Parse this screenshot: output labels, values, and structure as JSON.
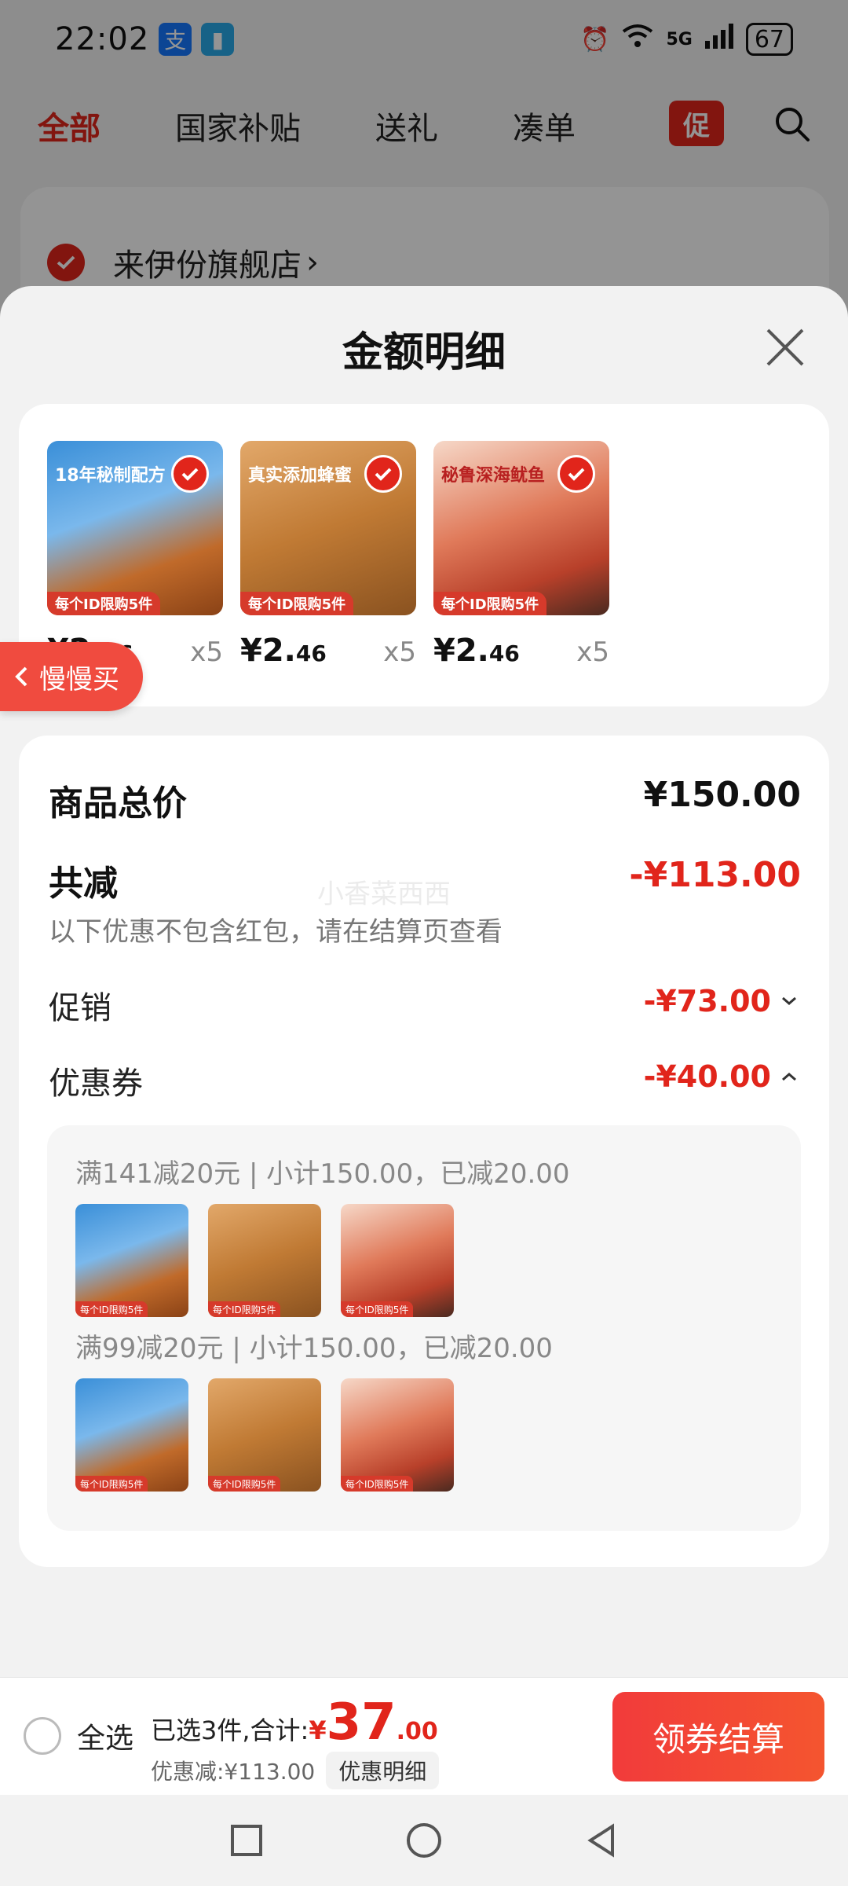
{
  "status_bar": {
    "time": "22:02",
    "battery": "67",
    "network": "5G"
  },
  "top_nav": {
    "items": [
      "全部",
      "国家补贴",
      "送礼",
      "凑单"
    ],
    "promo_label": "促"
  },
  "shop": {
    "name": "来伊份旗舰店",
    "chevron": "›"
  },
  "sheet": {
    "title": "金额明细",
    "products": [
      {
        "img_title": "18年秘制配方",
        "limit": "每个ID限购5件",
        "price_int": "¥2.",
        "price_dec": "46",
        "qty": "x5"
      },
      {
        "img_title": "真实添加蜂蜜",
        "limit": "每个ID限购5件",
        "price_int": "¥2.",
        "price_dec": "46",
        "qty": "x5"
      },
      {
        "img_title": "秘鲁深海鱿鱼",
        "limit": "每个ID限购5件",
        "price_int": "¥2.",
        "price_dec": "46",
        "qty": "x5"
      }
    ],
    "float_button": "慢慢买",
    "total_label": "商品总价",
    "total_value": "¥150.00",
    "reduce_label": "共减",
    "reduce_value": "-¥113.00",
    "reduce_note": "以下优惠不包含红包，请在结算页查看",
    "watermark": "小香菜西西",
    "promo_label": "促销",
    "promo_value": "-¥73.00",
    "coupon_label": "优惠券",
    "coupon_value": "-¥40.00",
    "coupon_rules": [
      "满141减20元 | 小计150.00，已减20.00",
      "满99减20元 | 小计150.00，已减20.00"
    ]
  },
  "bottom_bar": {
    "select_all": "全选",
    "selected_text": "已选3件,合计:",
    "currency": "¥",
    "total_int": "37",
    "total_dec": ".00",
    "discount_text": "优惠减:¥113.00",
    "detail_chip": "优惠明细",
    "checkout": "领券结算"
  },
  "colors": {
    "accent": "#e1251b",
    "button": "#f23b3b"
  }
}
